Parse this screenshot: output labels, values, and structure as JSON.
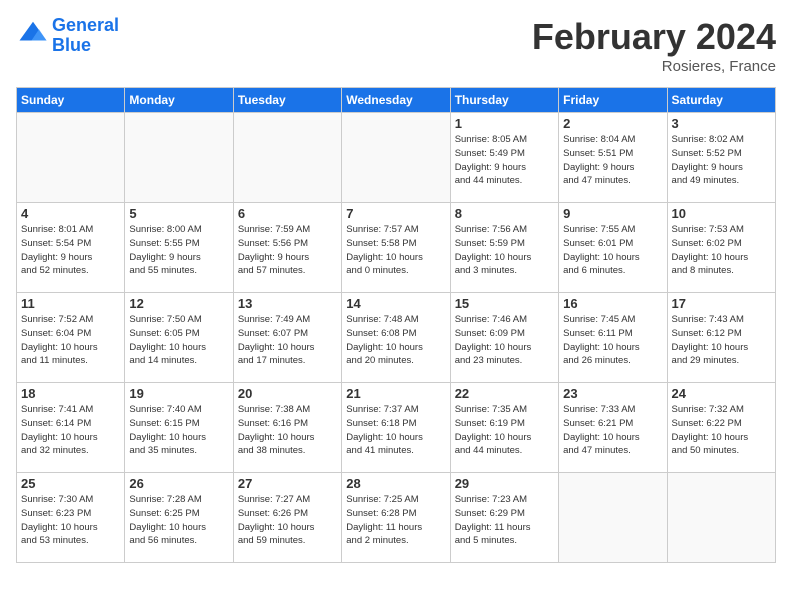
{
  "header": {
    "logo_line1": "General",
    "logo_line2": "Blue",
    "month_title": "February 2024",
    "location": "Rosieres, France"
  },
  "weekdays": [
    "Sunday",
    "Monday",
    "Tuesday",
    "Wednesday",
    "Thursday",
    "Friday",
    "Saturday"
  ],
  "weeks": [
    [
      {
        "day": "",
        "info": ""
      },
      {
        "day": "",
        "info": ""
      },
      {
        "day": "",
        "info": ""
      },
      {
        "day": "",
        "info": ""
      },
      {
        "day": "1",
        "info": "Sunrise: 8:05 AM\nSunset: 5:49 PM\nDaylight: 9 hours\nand 44 minutes."
      },
      {
        "day": "2",
        "info": "Sunrise: 8:04 AM\nSunset: 5:51 PM\nDaylight: 9 hours\nand 47 minutes."
      },
      {
        "day": "3",
        "info": "Sunrise: 8:02 AM\nSunset: 5:52 PM\nDaylight: 9 hours\nand 49 minutes."
      }
    ],
    [
      {
        "day": "4",
        "info": "Sunrise: 8:01 AM\nSunset: 5:54 PM\nDaylight: 9 hours\nand 52 minutes."
      },
      {
        "day": "5",
        "info": "Sunrise: 8:00 AM\nSunset: 5:55 PM\nDaylight: 9 hours\nand 55 minutes."
      },
      {
        "day": "6",
        "info": "Sunrise: 7:59 AM\nSunset: 5:56 PM\nDaylight: 9 hours\nand 57 minutes."
      },
      {
        "day": "7",
        "info": "Sunrise: 7:57 AM\nSunset: 5:58 PM\nDaylight: 10 hours\nand 0 minutes."
      },
      {
        "day": "8",
        "info": "Sunrise: 7:56 AM\nSunset: 5:59 PM\nDaylight: 10 hours\nand 3 minutes."
      },
      {
        "day": "9",
        "info": "Sunrise: 7:55 AM\nSunset: 6:01 PM\nDaylight: 10 hours\nand 6 minutes."
      },
      {
        "day": "10",
        "info": "Sunrise: 7:53 AM\nSunset: 6:02 PM\nDaylight: 10 hours\nand 8 minutes."
      }
    ],
    [
      {
        "day": "11",
        "info": "Sunrise: 7:52 AM\nSunset: 6:04 PM\nDaylight: 10 hours\nand 11 minutes."
      },
      {
        "day": "12",
        "info": "Sunrise: 7:50 AM\nSunset: 6:05 PM\nDaylight: 10 hours\nand 14 minutes."
      },
      {
        "day": "13",
        "info": "Sunrise: 7:49 AM\nSunset: 6:07 PM\nDaylight: 10 hours\nand 17 minutes."
      },
      {
        "day": "14",
        "info": "Sunrise: 7:48 AM\nSunset: 6:08 PM\nDaylight: 10 hours\nand 20 minutes."
      },
      {
        "day": "15",
        "info": "Sunrise: 7:46 AM\nSunset: 6:09 PM\nDaylight: 10 hours\nand 23 minutes."
      },
      {
        "day": "16",
        "info": "Sunrise: 7:45 AM\nSunset: 6:11 PM\nDaylight: 10 hours\nand 26 minutes."
      },
      {
        "day": "17",
        "info": "Sunrise: 7:43 AM\nSunset: 6:12 PM\nDaylight: 10 hours\nand 29 minutes."
      }
    ],
    [
      {
        "day": "18",
        "info": "Sunrise: 7:41 AM\nSunset: 6:14 PM\nDaylight: 10 hours\nand 32 minutes."
      },
      {
        "day": "19",
        "info": "Sunrise: 7:40 AM\nSunset: 6:15 PM\nDaylight: 10 hours\nand 35 minutes."
      },
      {
        "day": "20",
        "info": "Sunrise: 7:38 AM\nSunset: 6:16 PM\nDaylight: 10 hours\nand 38 minutes."
      },
      {
        "day": "21",
        "info": "Sunrise: 7:37 AM\nSunset: 6:18 PM\nDaylight: 10 hours\nand 41 minutes."
      },
      {
        "day": "22",
        "info": "Sunrise: 7:35 AM\nSunset: 6:19 PM\nDaylight: 10 hours\nand 44 minutes."
      },
      {
        "day": "23",
        "info": "Sunrise: 7:33 AM\nSunset: 6:21 PM\nDaylight: 10 hours\nand 47 minutes."
      },
      {
        "day": "24",
        "info": "Sunrise: 7:32 AM\nSunset: 6:22 PM\nDaylight: 10 hours\nand 50 minutes."
      }
    ],
    [
      {
        "day": "25",
        "info": "Sunrise: 7:30 AM\nSunset: 6:23 PM\nDaylight: 10 hours\nand 53 minutes."
      },
      {
        "day": "26",
        "info": "Sunrise: 7:28 AM\nSunset: 6:25 PM\nDaylight: 10 hours\nand 56 minutes."
      },
      {
        "day": "27",
        "info": "Sunrise: 7:27 AM\nSunset: 6:26 PM\nDaylight: 10 hours\nand 59 minutes."
      },
      {
        "day": "28",
        "info": "Sunrise: 7:25 AM\nSunset: 6:28 PM\nDaylight: 11 hours\nand 2 minutes."
      },
      {
        "day": "29",
        "info": "Sunrise: 7:23 AM\nSunset: 6:29 PM\nDaylight: 11 hours\nand 5 minutes."
      },
      {
        "day": "",
        "info": ""
      },
      {
        "day": "",
        "info": ""
      }
    ]
  ]
}
